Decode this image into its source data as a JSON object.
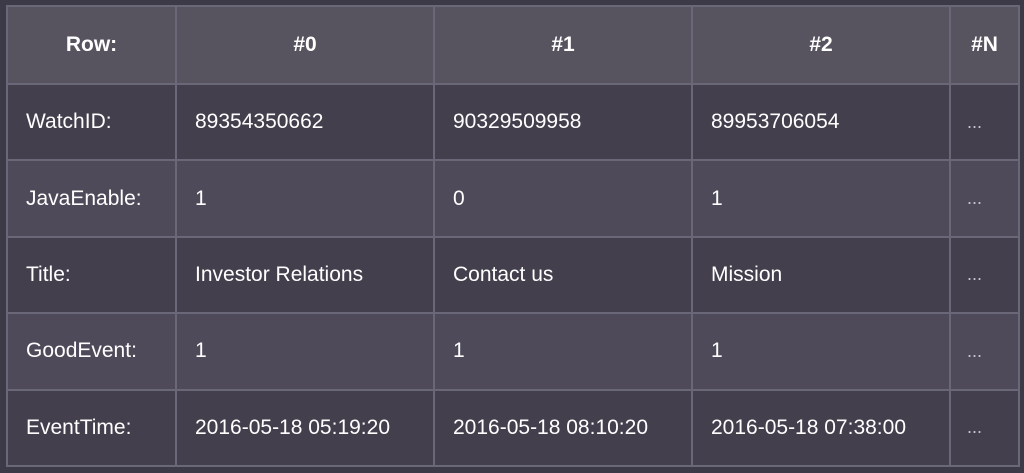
{
  "table": {
    "header": [
      "Row:",
      "#0",
      "#1",
      "#2",
      "#N"
    ],
    "rows": [
      {
        "label": "WatchID:",
        "cells": [
          "89354350662",
          "90329509958",
          "89953706054",
          "..."
        ]
      },
      {
        "label": "JavaEnable:",
        "cells": [
          "1",
          "0",
          "1",
          "..."
        ]
      },
      {
        "label": "Title:",
        "cells": [
          "Investor Relations",
          "Contact us",
          "Mission",
          "..."
        ]
      },
      {
        "label": "GoodEvent:",
        "cells": [
          "1",
          "1",
          "1",
          "..."
        ]
      },
      {
        "label": "EventTime:",
        "cells": [
          "2016-05-18 05:19:20",
          "2016-05-18 08:10:20",
          "2016-05-18 07:38:00",
          "..."
        ]
      }
    ]
  },
  "colors": {
    "background": "#3d3a48",
    "header_bg": "#57535f",
    "row_odd_bg": "#433f4d",
    "row_even_bg": "#4e4a59",
    "border": "#6a6778",
    "text": "#ffffff"
  }
}
